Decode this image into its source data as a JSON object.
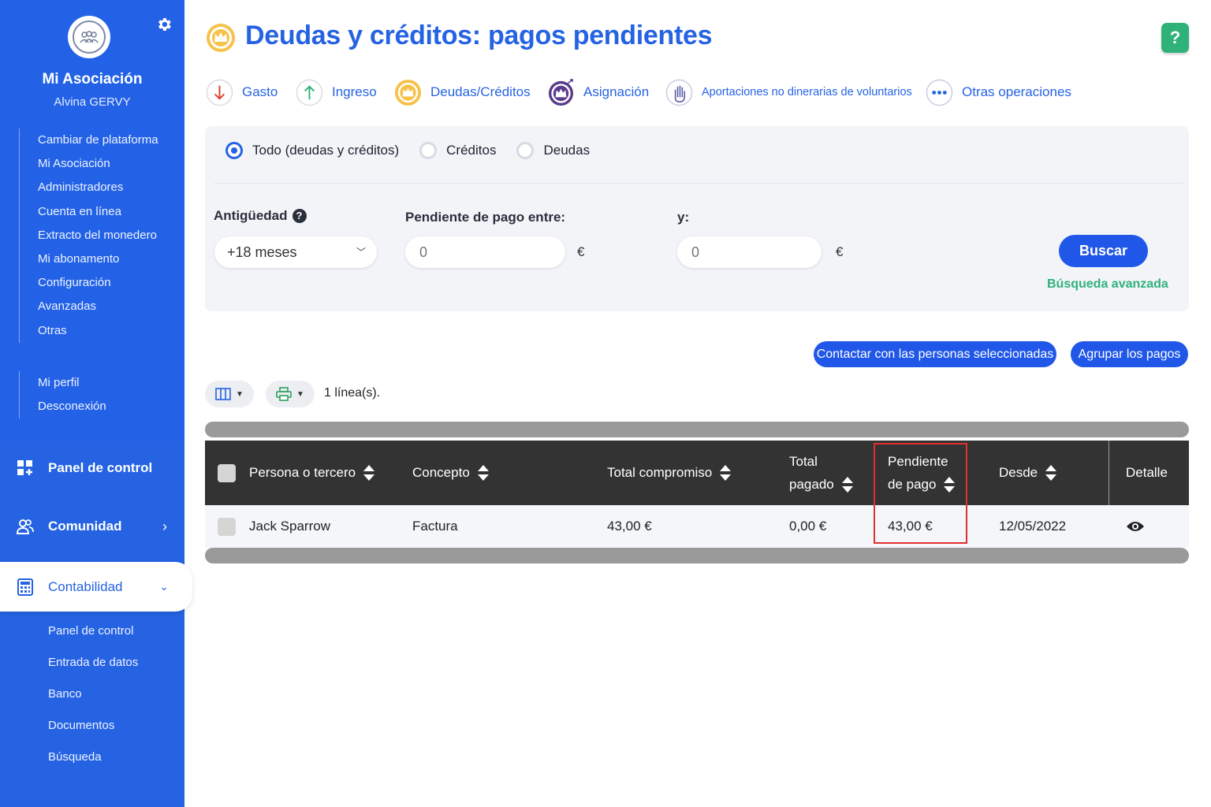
{
  "sidebar": {
    "association_name": "Mi Asociación",
    "user_name": "Alvina GERVY",
    "menu_top": [
      "Cambiar de plataforma",
      "Mi Asociación",
      "Administradores",
      "Cuenta en línea",
      "Extracto del monedero",
      "Mi abonamento",
      "Configuración",
      "Avanzadas",
      "Otras"
    ],
    "menu_profile": [
      "Mi perfil",
      "Desconexión"
    ],
    "nav": {
      "panel": "Panel de control",
      "comunidad": "Comunidad",
      "contabilidad": "Contabilidad"
    },
    "submenu": [
      "Panel de control",
      "Entrada de datos",
      "Banco",
      "Documentos",
      "Búsqueda"
    ]
  },
  "header": {
    "title": "Deudas y créditos: pagos pendientes",
    "help": "?"
  },
  "operations": [
    {
      "label": "Gasto",
      "icon": "arrow-down-icon"
    },
    {
      "label": "Ingreso",
      "icon": "arrow-up-icon"
    },
    {
      "label": "Deudas/Créditos",
      "icon": "crown-icon"
    },
    {
      "label": "Asignación",
      "icon": "crown-arrow-icon"
    },
    {
      "label": "Aportaciones no dinerarias de voluntarios",
      "icon": "hand-icon"
    },
    {
      "label": "Otras operaciones",
      "icon": "more-icon"
    }
  ],
  "filter": {
    "radios": [
      "Todo (deudas y créditos)",
      "Créditos",
      "Deudas"
    ],
    "selected_radio": "Todo (deudas y créditos)",
    "antiguedad_label": "Antigüedad",
    "antiguedad_value": "+18 meses",
    "pendiente_label": "Pendiente de pago entre:",
    "y_label": "y:",
    "min_placeholder": "0",
    "max_placeholder": "0",
    "currency": "€",
    "search_button": "Buscar",
    "advanced_link": "Búsqueda avanzada"
  },
  "actions": {
    "contact": "Contactar con las personas seleccionadas",
    "group": "Agrupar los pagos"
  },
  "toolbar": {
    "line_count": "1 línea(s)."
  },
  "table": {
    "headers": {
      "persona": "Persona o tercero",
      "concepto": "Concepto",
      "total_compromiso": "Total compromiso",
      "total_pagado_1": "Total",
      "total_pagado_2": "pagado",
      "pendiente_1": "Pendiente",
      "pendiente_2": "de pago",
      "desde": "Desde",
      "detalle": "Detalle"
    },
    "rows": [
      {
        "persona": "Jack Sparrow",
        "concepto": "Factura",
        "total_compromiso": "43,00 €",
        "total_pagado": "0,00 €",
        "pendiente": "43,00 €",
        "desde": "12/05/2022"
      }
    ]
  },
  "colors": {
    "brand_blue": "#2563e3",
    "accent_green": "#2fb27a",
    "highlight_red": "#e03030",
    "header_dark": "#333333"
  }
}
